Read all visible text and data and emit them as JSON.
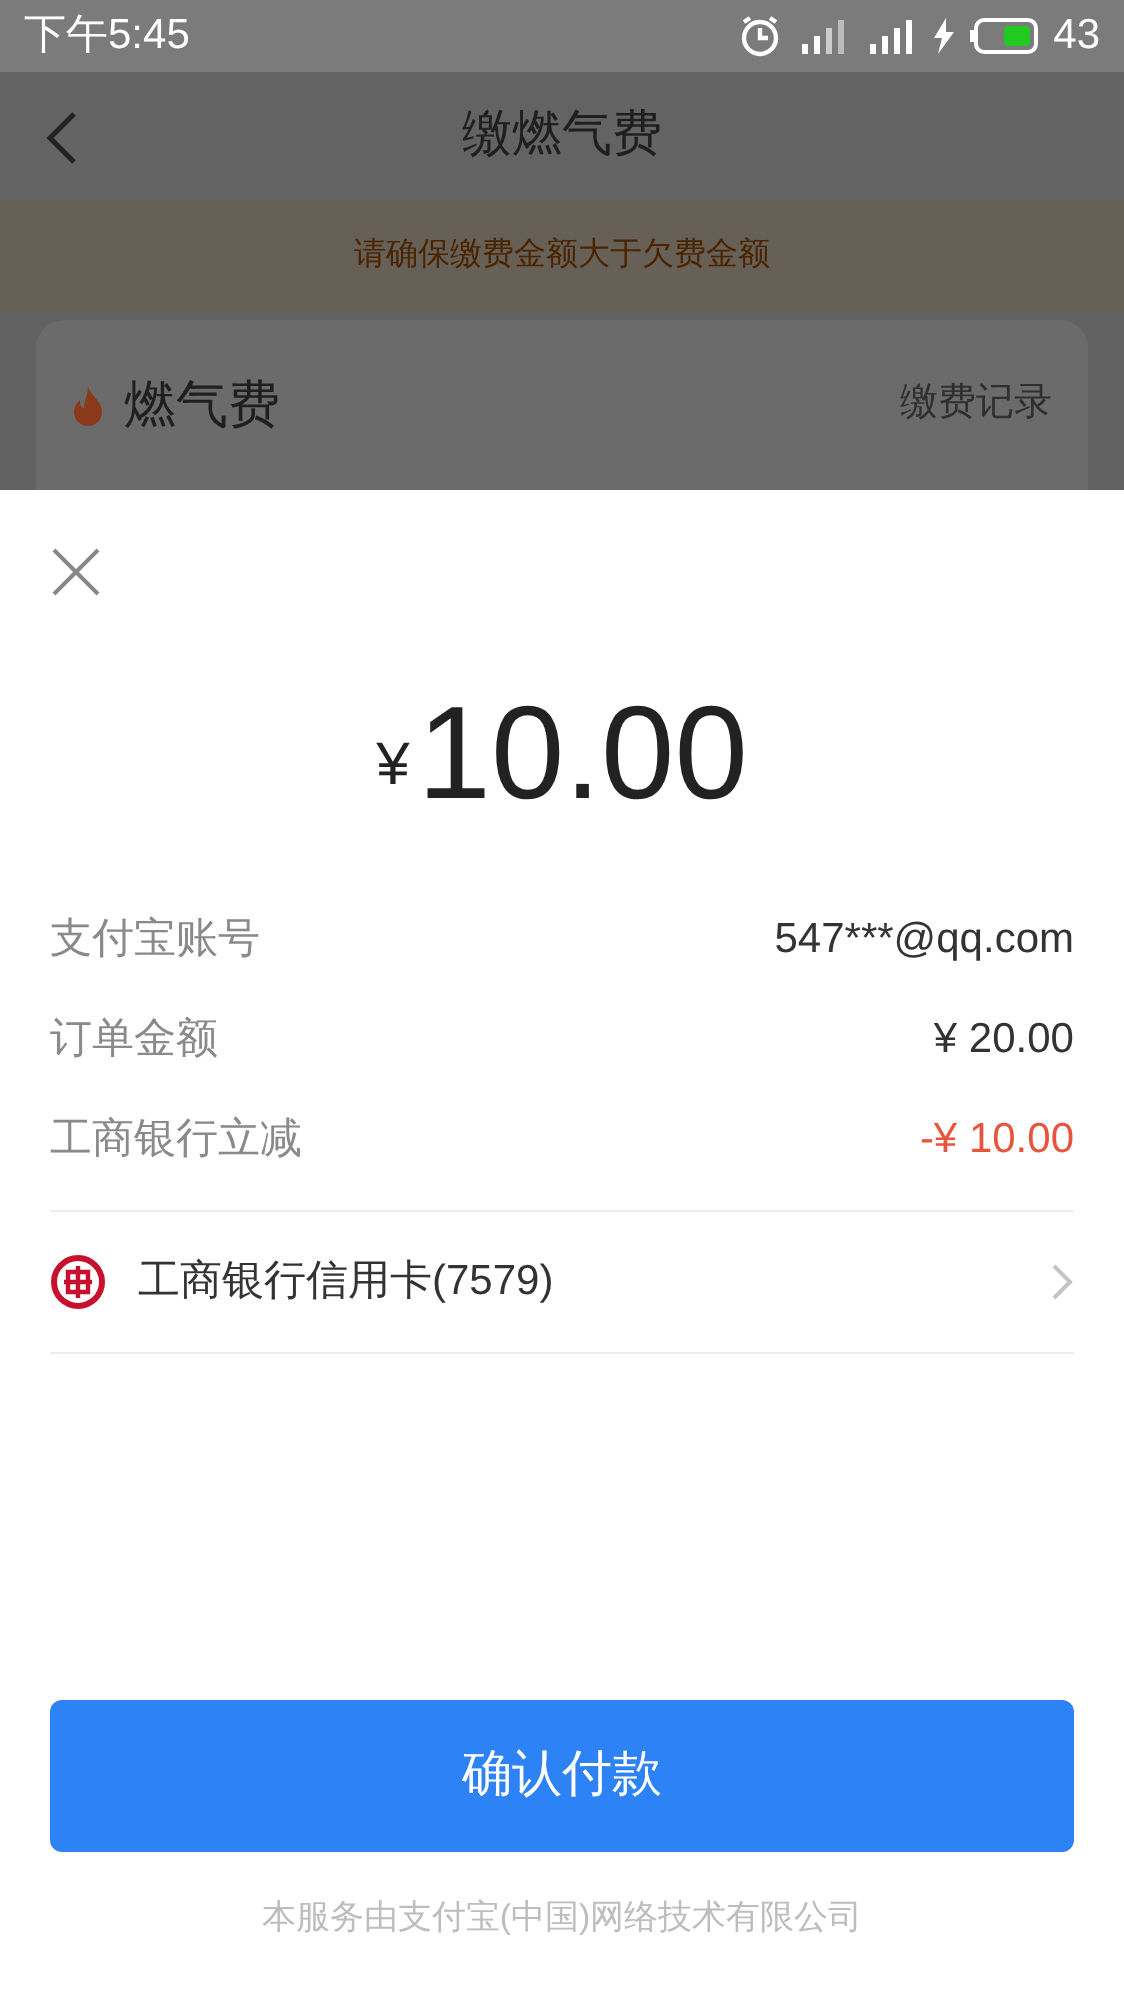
{
  "status_bar": {
    "time": "下午5:45",
    "battery": "43"
  },
  "header": {
    "title": "缴燃气费"
  },
  "notice": "请确保缴费金额大于欠费金额",
  "card": {
    "title": "燃气费",
    "link": "缴费记录"
  },
  "sheet": {
    "currency": "¥",
    "amount": "10.00",
    "rows": [
      {
        "label": "支付宝账号",
        "value": "547***@qq.com",
        "kind": "normal"
      },
      {
        "label": "订单金额",
        "value": "¥ 20.00",
        "kind": "normal"
      },
      {
        "label": "工商银行立减",
        "value": "-¥ 10.00",
        "kind": "discount"
      }
    ],
    "payment_method": "工商银行信用卡(7579)",
    "confirm_button": "确认付款",
    "footer": "本服务由支付宝(中国)网络技术有限公司"
  }
}
